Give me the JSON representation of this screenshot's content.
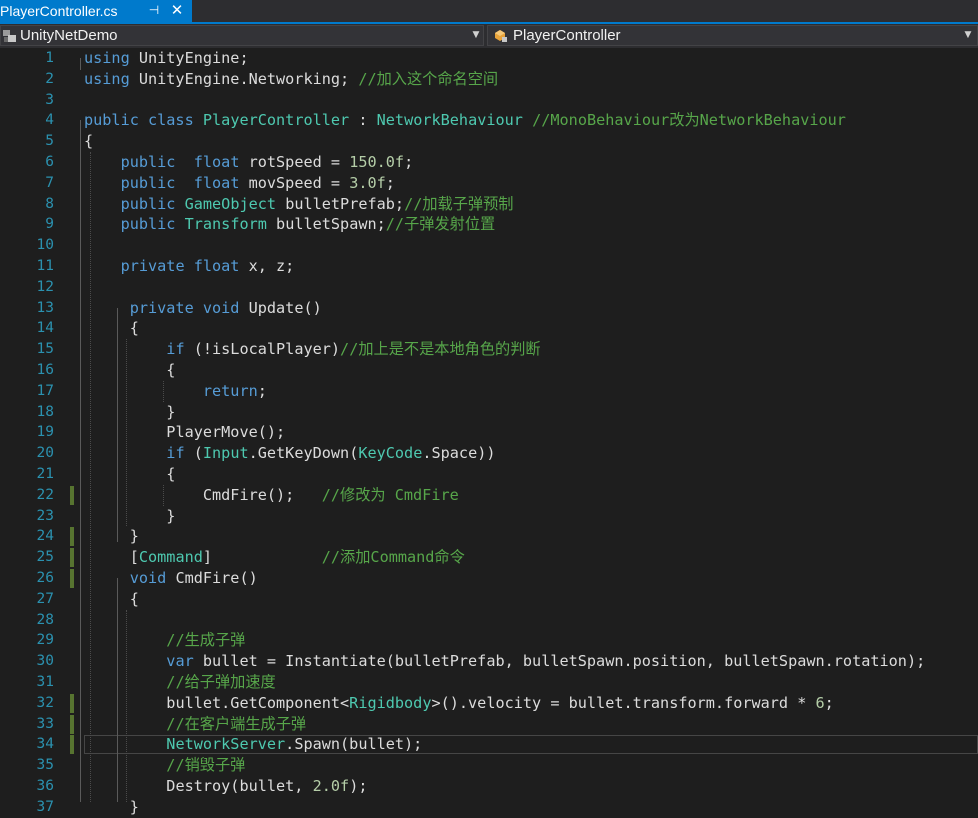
{
  "tab": {
    "title": "PlayerController.cs",
    "pin_icon": "pin-icon",
    "close_icon": "close-icon"
  },
  "nav": {
    "project": "UnityNetDemo",
    "class": "PlayerController"
  },
  "colors": {
    "keyword": "#569cd6",
    "type": "#4ec9b0",
    "comment": "#57a64a",
    "number": "#b5cea8",
    "text": "#dcdcdc",
    "line_number": "#2b91af",
    "accent": "#007acc",
    "change_marker": "#577430"
  },
  "lines": [
    {
      "n": "1",
      "indent": "",
      "tokens": [
        [
          "kw",
          "using"
        ],
        [
          "tx",
          " UnityEngine;"
        ]
      ]
    },
    {
      "n": "2",
      "indent": "",
      "tokens": [
        [
          "kw",
          "using"
        ],
        [
          "tx",
          " UnityEngine.Networking; "
        ],
        [
          "cm",
          "//加入这个命名空间"
        ]
      ]
    },
    {
      "n": "3",
      "indent": "",
      "tokens": []
    },
    {
      "n": "4",
      "indent": "",
      "tokens": [
        [
          "kw",
          "public class"
        ],
        [
          "tx",
          " "
        ],
        [
          "ty",
          "PlayerController"
        ],
        [
          "tx",
          " : "
        ],
        [
          "ty",
          "NetworkBehaviour"
        ],
        [
          "tx",
          " "
        ],
        [
          "cm",
          "//MonoBehaviour改为NetworkBehaviour"
        ]
      ]
    },
    {
      "n": "5",
      "indent": "",
      "tokens": [
        [
          "tx",
          "{"
        ]
      ]
    },
    {
      "n": "6",
      "indent": "    ",
      "tokens": [
        [
          "kw",
          "public"
        ],
        [
          "tx",
          "  "
        ],
        [
          "kw",
          "float"
        ],
        [
          "tx",
          " rotSpeed = "
        ],
        [
          "nm",
          "150.0f"
        ],
        [
          "tx",
          ";"
        ]
      ]
    },
    {
      "n": "7",
      "indent": "    ",
      "tokens": [
        [
          "kw",
          "public"
        ],
        [
          "tx",
          "  "
        ],
        [
          "kw",
          "float"
        ],
        [
          "tx",
          " movSpeed = "
        ],
        [
          "nm",
          "3.0f"
        ],
        [
          "tx",
          ";"
        ]
      ]
    },
    {
      "n": "8",
      "indent": "    ",
      "tokens": [
        [
          "kw",
          "public"
        ],
        [
          "tx",
          " "
        ],
        [
          "ty",
          "GameObject"
        ],
        [
          "tx",
          " bulletPrefab;"
        ],
        [
          "cm",
          "//加载子弹预制"
        ]
      ]
    },
    {
      "n": "9",
      "indent": "    ",
      "tokens": [
        [
          "kw",
          "public"
        ],
        [
          "tx",
          " "
        ],
        [
          "ty",
          "Transform"
        ],
        [
          "tx",
          " bulletSpawn;"
        ],
        [
          "cm",
          "//子弹发射位置"
        ]
      ]
    },
    {
      "n": "10",
      "indent": "",
      "tokens": []
    },
    {
      "n": "11",
      "indent": "    ",
      "tokens": [
        [
          "kw",
          "private float"
        ],
        [
          "tx",
          " x, z;"
        ]
      ]
    },
    {
      "n": "12",
      "indent": "",
      "tokens": []
    },
    {
      "n": "13",
      "indent": "     ",
      "tokens": [
        [
          "kw",
          "private void"
        ],
        [
          "tx",
          " Update()"
        ]
      ]
    },
    {
      "n": "14",
      "indent": "     ",
      "tokens": [
        [
          "tx",
          "{"
        ]
      ]
    },
    {
      "n": "15",
      "indent": "         ",
      "tokens": [
        [
          "kw",
          "if"
        ],
        [
          "tx",
          " (!isLocalPlayer)"
        ],
        [
          "cm",
          "//加上是不是本地角色的判断"
        ]
      ]
    },
    {
      "n": "16",
      "indent": "         ",
      "tokens": [
        [
          "tx",
          "{"
        ]
      ]
    },
    {
      "n": "17",
      "indent": "             ",
      "tokens": [
        [
          "kw",
          "return"
        ],
        [
          "tx",
          ";"
        ]
      ]
    },
    {
      "n": "18",
      "indent": "         ",
      "tokens": [
        [
          "tx",
          "}"
        ]
      ]
    },
    {
      "n": "19",
      "indent": "         ",
      "tokens": [
        [
          "tx",
          "PlayerMove();"
        ]
      ]
    },
    {
      "n": "20",
      "indent": "         ",
      "tokens": [
        [
          "kw",
          "if"
        ],
        [
          "tx",
          " ("
        ],
        [
          "ty",
          "Input"
        ],
        [
          "tx",
          ".GetKeyDown("
        ],
        [
          "ty",
          "KeyCode"
        ],
        [
          "tx",
          ".Space))"
        ]
      ]
    },
    {
      "n": "21",
      "indent": "         ",
      "tokens": [
        [
          "tx",
          "{"
        ]
      ]
    },
    {
      "n": "22",
      "indent": "             ",
      "changed": true,
      "tokens": [
        [
          "tx",
          "CmdFire();   "
        ],
        [
          "cm",
          "//修改为 CmdFire"
        ]
      ]
    },
    {
      "n": "23",
      "indent": "         ",
      "tokens": [
        [
          "tx",
          "}"
        ]
      ]
    },
    {
      "n": "24",
      "indent": "     ",
      "changed": true,
      "tokens": [
        [
          "tx",
          "}"
        ]
      ]
    },
    {
      "n": "25",
      "indent": "     ",
      "changed": true,
      "tokens": [
        [
          "tx",
          "["
        ],
        [
          "ty",
          "Command"
        ],
        [
          "tx",
          "]            "
        ],
        [
          "cm",
          "//添加Command命令"
        ]
      ]
    },
    {
      "n": "26",
      "indent": "     ",
      "changed": true,
      "tokens": [
        [
          "kw",
          "void"
        ],
        [
          "tx",
          " CmdFire()"
        ]
      ]
    },
    {
      "n": "27",
      "indent": "     ",
      "tokens": [
        [
          "tx",
          "{"
        ]
      ]
    },
    {
      "n": "28",
      "indent": "",
      "tokens": []
    },
    {
      "n": "29",
      "indent": "         ",
      "tokens": [
        [
          "cm",
          "//生成子弹"
        ]
      ]
    },
    {
      "n": "30",
      "indent": "         ",
      "tokens": [
        [
          "kw",
          "var"
        ],
        [
          "tx",
          " bullet = Instantiate(bulletPrefab, bulletSpawn.position, bulletSpawn.rotation);"
        ]
      ]
    },
    {
      "n": "31",
      "indent": "         ",
      "tokens": [
        [
          "cm",
          "//给子弹加速度"
        ]
      ]
    },
    {
      "n": "32",
      "indent": "         ",
      "changed": true,
      "tokens": [
        [
          "tx",
          "bullet.GetComponent<"
        ],
        [
          "ty",
          "Rigidbody"
        ],
        [
          "tx",
          ">().velocity = bullet.transform.forward * "
        ],
        [
          "nm",
          "6"
        ],
        [
          "tx",
          ";"
        ]
      ]
    },
    {
      "n": "33",
      "indent": "         ",
      "changed": true,
      "tokens": [
        [
          "cm",
          "//在客户端生成子弹"
        ]
      ]
    },
    {
      "n": "34",
      "indent": "         ",
      "changed": true,
      "current": true,
      "tokens": [
        [
          "ty",
          "NetworkServer"
        ],
        [
          "tx",
          ".Spawn(bullet);"
        ]
      ]
    },
    {
      "n": "35",
      "indent": "         ",
      "tokens": [
        [
          "cm",
          "//销毁子弹"
        ]
      ]
    },
    {
      "n": "36",
      "indent": "         ",
      "tokens": [
        [
          "tx",
          "Destroy(bullet, "
        ],
        [
          "nm",
          "2.0f"
        ],
        [
          "tx",
          ");"
        ]
      ]
    },
    {
      "n": "37",
      "indent": "     ",
      "tokens": [
        [
          "tx",
          "}"
        ]
      ]
    }
  ]
}
